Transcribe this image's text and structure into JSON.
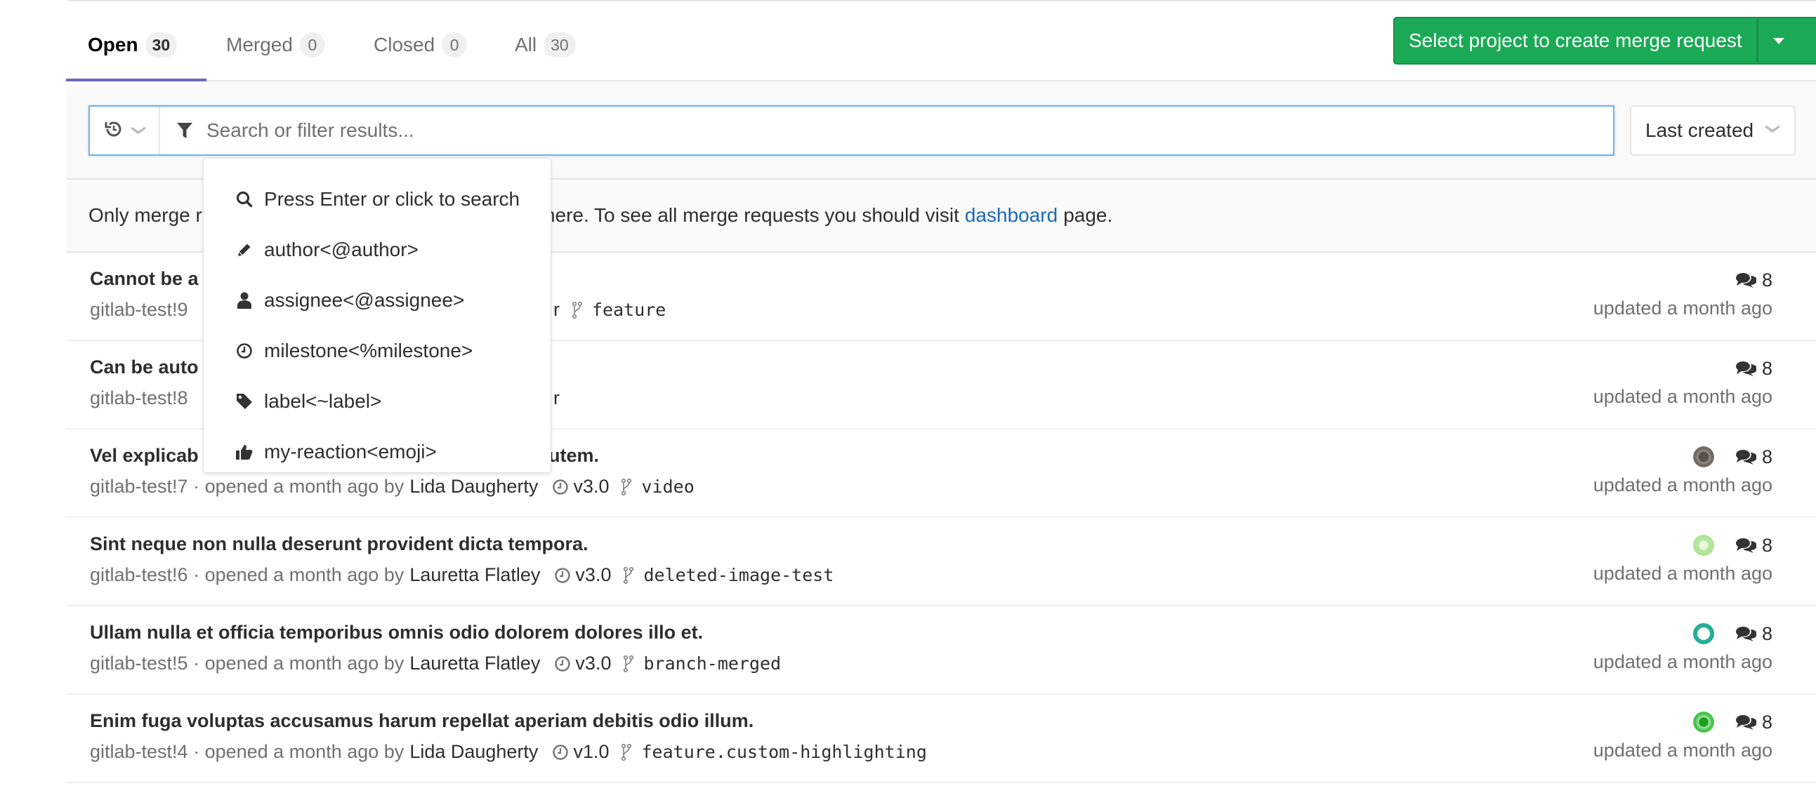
{
  "tabs": [
    {
      "label": "Open",
      "count": "30",
      "active": true
    },
    {
      "label": "Merged",
      "count": "0",
      "active": false
    },
    {
      "label": "Closed",
      "count": "0",
      "active": false
    },
    {
      "label": "All",
      "count": "30",
      "active": false
    }
  ],
  "create_button": {
    "label": "Select project to create merge request",
    "caret_icon": "caret-down-icon"
  },
  "filter": {
    "history_icon": "history-icon",
    "filter_icon": "filter-icon",
    "placeholder": "Search or filter results...",
    "value": "",
    "sort": {
      "selected": "Last created"
    }
  },
  "dropdown": {
    "items": [
      {
        "icon": "search-icon",
        "label": "Press Enter or click to search"
      },
      {
        "icon": "pencil-icon",
        "label": "author<@author>"
      },
      {
        "icon": "user-icon",
        "label": "assignee<@assignee>"
      },
      {
        "icon": "clock-icon",
        "label": "milestone<%milestone>"
      },
      {
        "icon": "tag-icon",
        "label": "label<~label>"
      },
      {
        "icon": "thumbs-up-icon",
        "label": "my-reaction<emoji>"
      }
    ]
  },
  "info": {
    "prefix": "Only merge requests from this project are displayed here. To see all merge requests you should visit",
    "link": "dashboard",
    "suffix": "page."
  },
  "merge_requests": [
    {
      "title": "Cannot be a",
      "ref": "gitlab-test!9",
      "tail": "r",
      "branch": "feature",
      "comments": "8",
      "updated": "updated a month ago",
      "avatar": null
    },
    {
      "title": "Can be auto",
      "ref": "gitlab-test!8",
      "tail": "r",
      "branch": "",
      "comments": "8",
      "updated": "updated a month ago",
      "avatar": null
    },
    {
      "title": "Vel explicab",
      "title_tail": "utem.",
      "ref": "gitlab-test!7",
      "opened": "· opened a month ago by",
      "author": "Lida Daugherty",
      "milestone": "v3.0",
      "branch": "video",
      "comments": "8",
      "updated": "updated a month ago",
      "avatar": "#6b625c"
    },
    {
      "title": "Sint neque non nulla deserunt provident dicta tempora.",
      "ref": "gitlab-test!6",
      "opened": "· opened a month ago by",
      "author": "Lauretta Flatley",
      "milestone": "v3.0",
      "branch": "deleted-image-test",
      "comments": "8",
      "updated": "updated a month ago",
      "avatar": "#b7e8a0"
    },
    {
      "title": "Ullam nulla et officia temporibus omnis odio dolorem dolores illo et.",
      "ref": "gitlab-test!5",
      "opened": "· opened a month ago by",
      "author": "Lauretta Flatley",
      "milestone": "v3.0",
      "branch": "branch-merged",
      "comments": "8",
      "updated": "updated a month ago",
      "avatar": "#2bb39a"
    },
    {
      "title": "Enim fuga voluptas accusamus harum repellat aperiam debitis odio illum.",
      "ref": "gitlab-test!4",
      "opened": "· opened a month ago by",
      "author": "Lida Daugherty",
      "milestone": "v1.0",
      "branch": "feature.custom-highlighting",
      "comments": "8",
      "updated": "updated a month ago",
      "avatar": "#3cbf3c"
    }
  ],
  "colors": {
    "accent": "#6b67c4",
    "create_button": "#1aaa55",
    "link": "#1b69b6",
    "focus_border": "#73afea"
  }
}
